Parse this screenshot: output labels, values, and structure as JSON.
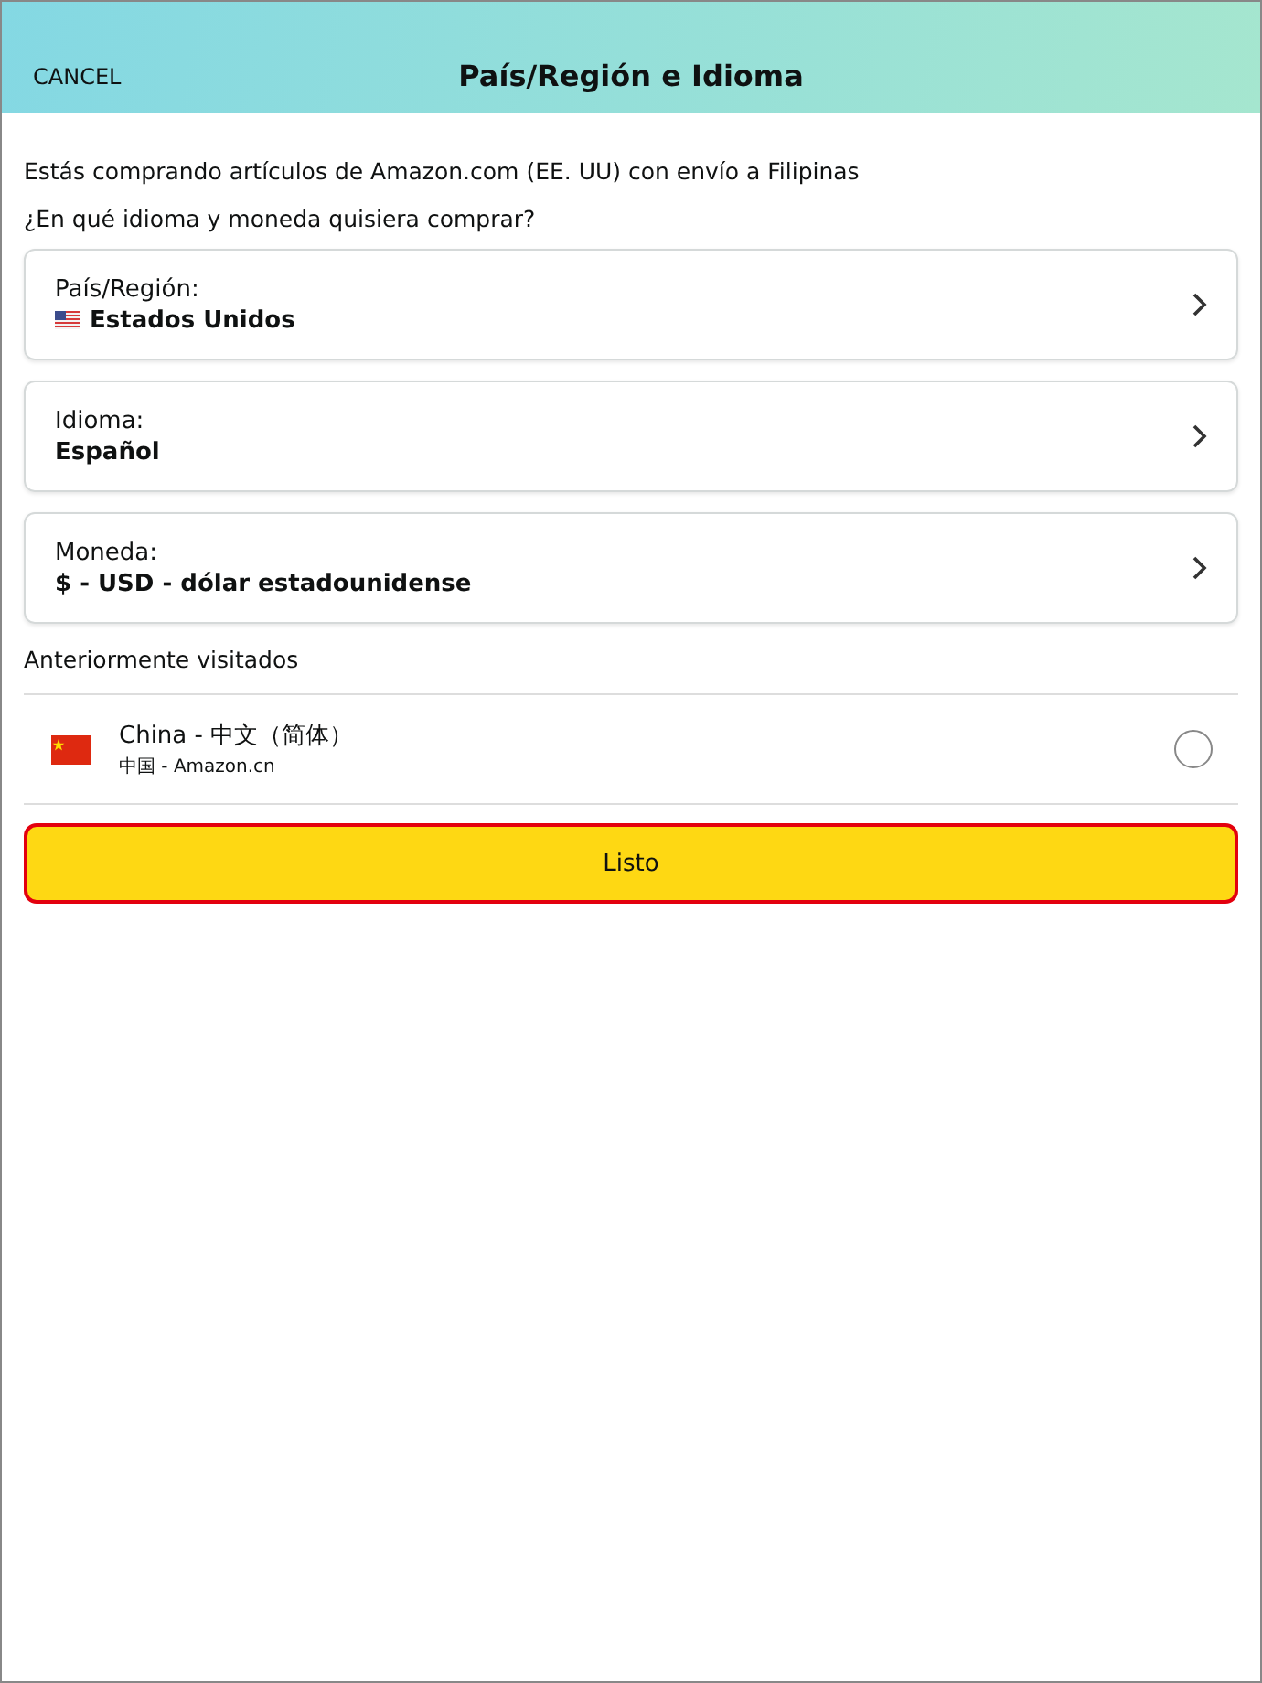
{
  "header": {
    "cancel": "CANCEL",
    "title": "País/Región e Idioma"
  },
  "intro": "Estás comprando artículos de Amazon.com (EE. UU) con envío a Filipinas",
  "question": "¿En qué idioma y moneda quisiera comprar?",
  "settings": [
    {
      "label": "País/Región:",
      "value": "Estados Unidos",
      "kind": "us_flag"
    },
    {
      "label": "Idioma:",
      "value": "Español",
      "kind": "plain"
    },
    {
      "label": "Moneda:",
      "value": "$ - USD - dólar estadounidense",
      "kind": "plain"
    }
  ],
  "visited_heading": "Anteriormente visitados",
  "visited": [
    {
      "kind": "cn_flag",
      "title": "China - 中文（简体）",
      "subtitle": "中国 - Amazon.cn",
      "selected": false
    }
  ],
  "done_button": "Listo"
}
